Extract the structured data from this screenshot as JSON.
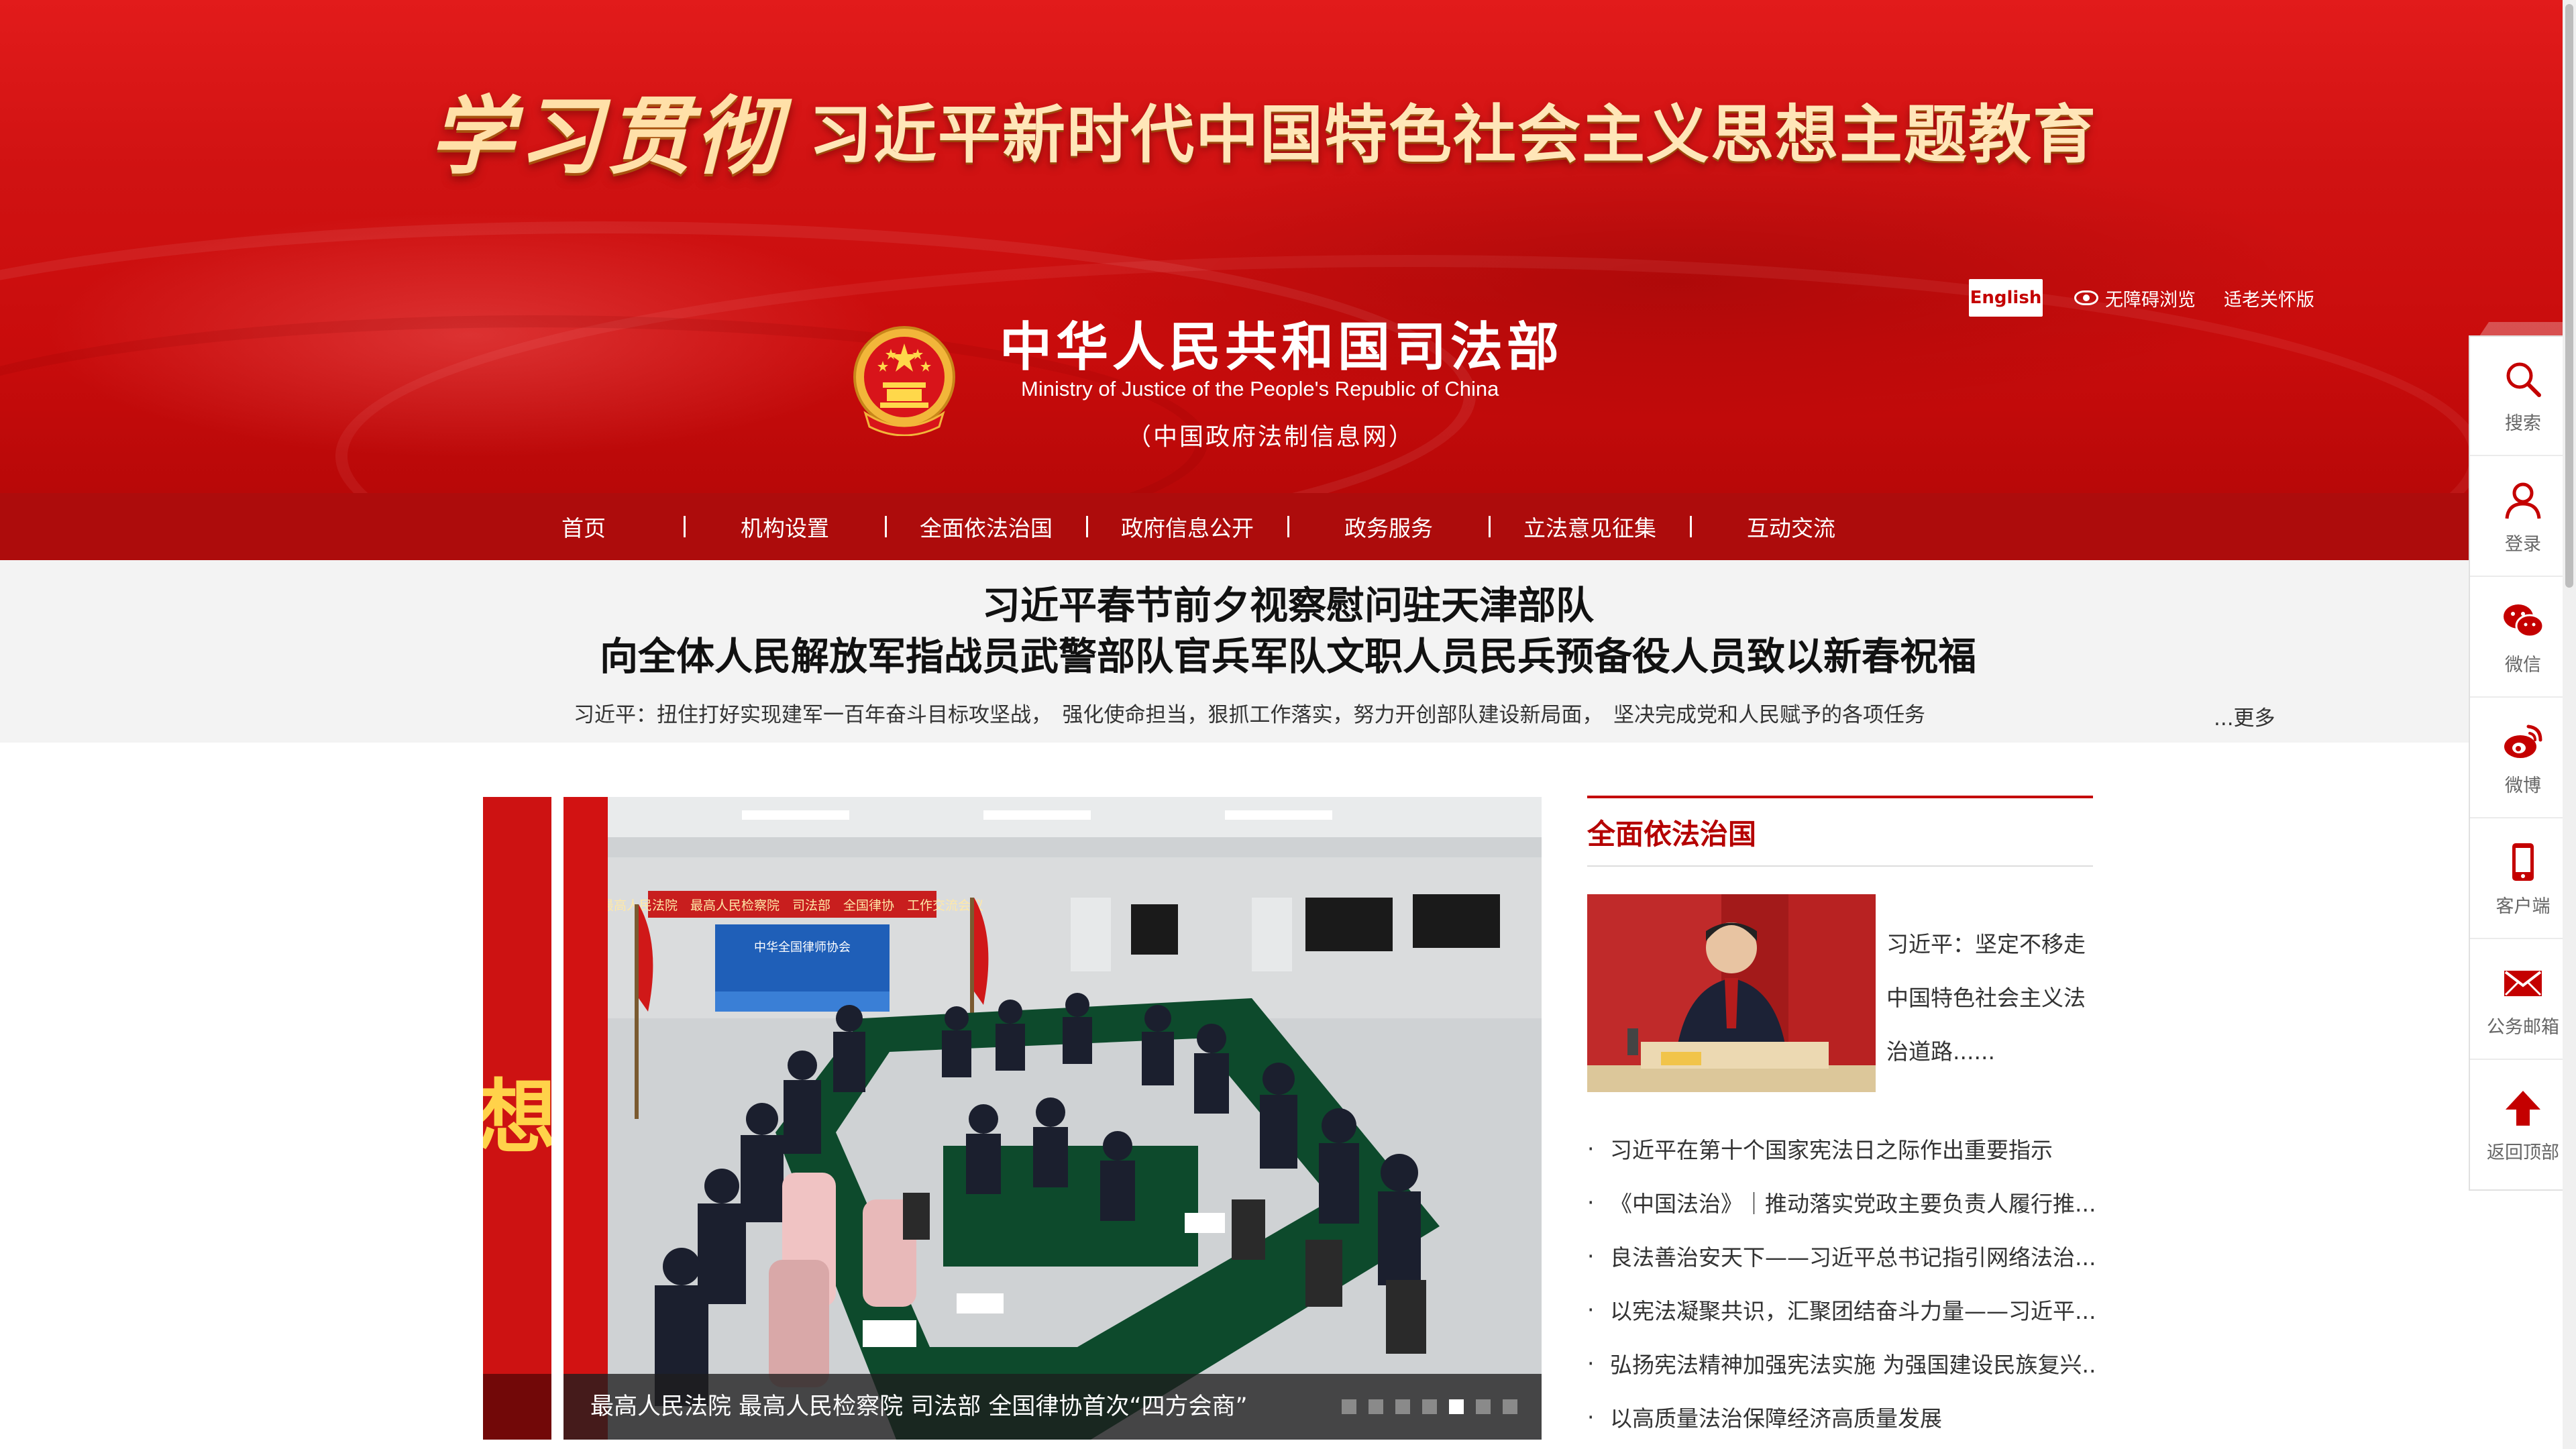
{
  "banner": {
    "slogan_script": "学习贯彻",
    "slogan_main": "习近平新时代中国特色社会主义思想主题教育"
  },
  "header": {
    "english_label": "English",
    "accessibility_label": "无障碍浏览",
    "elder_label": "适老关怀版",
    "ministry_name": "中华人民共和国司法部",
    "ministry_en": "Ministry of Justice of the People's Republic of China",
    "ministry_sub": "（中国政府法制信息网）"
  },
  "nav": {
    "items": [
      {
        "label": "首页"
      },
      {
        "label": "机构设置"
      },
      {
        "label": "全面依法治国"
      },
      {
        "label": "政府信息公开"
      },
      {
        "label": "政务服务"
      },
      {
        "label": "立法意见征集"
      },
      {
        "label": "互动交流"
      }
    ]
  },
  "headline": {
    "line1": "习近平春节前夕视察慰问驻天津部队",
    "line2": "向全体人民解放军指战员武警部队官兵军队文职人员民兵预备役人员致以新春祝福",
    "subtitle": "习近平：扭住打好实现建军一百年奋斗目标攻坚战，　强化使命担当，狠抓工作落实，努力开创部队建设新局面，　坚决完成党和人民赋予的各项任务",
    "more": "...更多"
  },
  "carousel": {
    "side_glyph": "想",
    "photo_banner_text": "最高人民法院　最高人民检察院　司法部　全国律协　工作交流会议",
    "photo_screen_text": "中华全国律师协会",
    "caption": "最高人民法院 最高人民检察院 司法部 全国律协首次“四方会商”",
    "dot_count": 7,
    "active_dot": 5
  },
  "rule_of_law": {
    "title": "全面依法治国",
    "feature": "习近平：坚定不移走中国特色社会主义法治道路......",
    "items": [
      "习近平在第十个国家宪法日之际作出重要指示",
      "《中国法治》｜推动落实党政主要负责人履行推...",
      "良法善治安天下——习近平总书记指引网络法治...",
      "以宪法凝聚共识，汇聚团结奋斗力量——习近平...",
      "弘扬宪法精神加强宪法实施 为强国建设民族复兴...",
      "以高质量法治保障经济高质量发展"
    ]
  },
  "sidebar": {
    "items": [
      {
        "label": "搜索",
        "icon": "search-icon"
      },
      {
        "label": "登录",
        "icon": "user-icon"
      },
      {
        "label": "微信",
        "icon": "wechat-icon"
      },
      {
        "label": "微博",
        "icon": "weibo-icon"
      },
      {
        "label": "客户端",
        "icon": "mobile-icon"
      },
      {
        "label": "公务邮箱",
        "icon": "mail-icon"
      },
      {
        "label": "返回顶部",
        "icon": "arrow-up-icon"
      }
    ]
  },
  "colors": {
    "brand_red": "#c40000",
    "nav_red": "#ad0c0c",
    "gold": "#ffd24a"
  }
}
